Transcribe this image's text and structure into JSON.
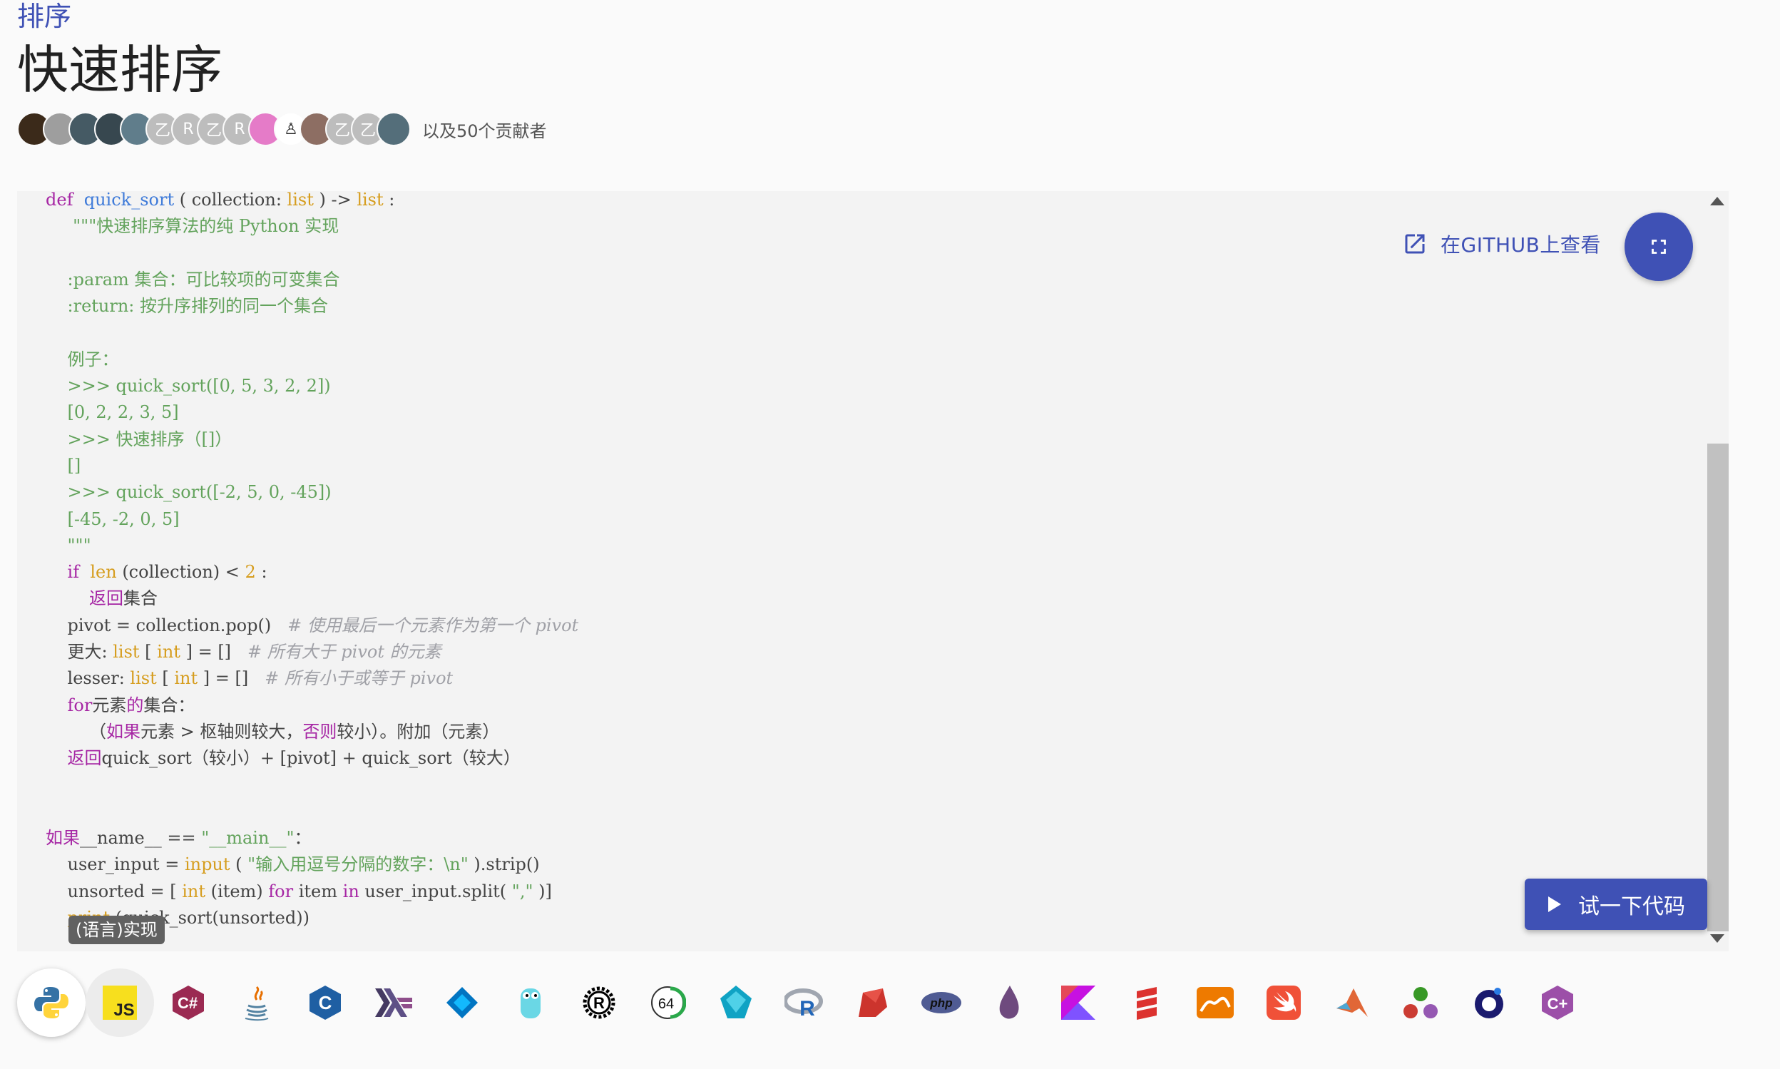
{
  "breadcrumb": "排序",
  "title": "快速排序",
  "contributors": {
    "avatars": [
      {
        "kind": "photo",
        "color": "#3b2a1a"
      },
      {
        "kind": "photo",
        "color": "#9e9e9e"
      },
      {
        "kind": "photo",
        "color": "#455a64"
      },
      {
        "kind": "photo",
        "color": "#37474f"
      },
      {
        "kind": "photo",
        "color": "#607d8b"
      },
      {
        "kind": "letter",
        "letter": "乙",
        "color": "#bdbdbd"
      },
      {
        "kind": "letter",
        "letter": "R",
        "color": "#bdbdbd"
      },
      {
        "kind": "letter",
        "letter": "乙",
        "color": "#bdbdbd"
      },
      {
        "kind": "letter",
        "letter": "R",
        "color": "#bdbdbd"
      },
      {
        "kind": "letter",
        "letter": "",
        "color": "#e57bc8"
      },
      {
        "kind": "letter",
        "letter": "♙",
        "color": "#ffffff"
      },
      {
        "kind": "photo",
        "color": "#8d6e63"
      },
      {
        "kind": "letter",
        "letter": "乙",
        "color": "#bdbdbd"
      },
      {
        "kind": "letter",
        "letter": "乙",
        "color": "#bdbdbd"
      },
      {
        "kind": "photo",
        "color": "#546e7a"
      }
    ],
    "more_text": "以及50个贡献者"
  },
  "code_lines": [
    [
      {
        "t": "def  ",
        "c": "m"
      },
      {
        "t": "quick_sort",
        "c": "b"
      },
      {
        "t": " ( collection: "
      },
      {
        "t": "list",
        "c": "o"
      },
      {
        "t": " ) -> "
      },
      {
        "t": "list",
        "c": "o"
      },
      {
        "t": " :"
      }
    ],
    [
      {
        "t": "     \"\"\"快速排序算法的纯 Python 实现",
        "c": "g"
      }
    ],
    [
      {
        "t": ""
      }
    ],
    [
      {
        "t": "    :param 集合：可比较项的可变集合",
        "c": "g"
      }
    ],
    [
      {
        "t": "    :return: 按升序排列的同一个集合",
        "c": "g"
      }
    ],
    [
      {
        "t": ""
      }
    ],
    [
      {
        "t": "    例子：",
        "c": "g"
      }
    ],
    [
      {
        "t": "    >>> quick_sort([0, 5, 3, 2, 2])",
        "c": "g"
      }
    ],
    [
      {
        "t": "    [0, 2, 2, 3, 5]",
        "c": "g"
      }
    ],
    [
      {
        "t": "    >>> 快速排序（[]）",
        "c": "g"
      }
    ],
    [
      {
        "t": "    []",
        "c": "g"
      }
    ],
    [
      {
        "t": "    >>> quick_sort([-2, 5, 0, -45])",
        "c": "g"
      }
    ],
    [
      {
        "t": "    [-45, -2, 0, 5]",
        "c": "g"
      }
    ],
    [
      {
        "t": "    \"\"\"",
        "c": "g"
      }
    ],
    [
      {
        "t": "    "
      },
      {
        "t": "if",
        "c": "m"
      },
      {
        "t": "  "
      },
      {
        "t": "len",
        "c": "o"
      },
      {
        "t": " (collection) < "
      },
      {
        "t": "2",
        "c": "o"
      },
      {
        "t": " :"
      }
    ],
    [
      {
        "t": "        "
      },
      {
        "t": "返回",
        "c": "m"
      },
      {
        "t": "集合"
      }
    ],
    [
      {
        "t": "    pivot = collection.pop()   "
      },
      {
        "t": "# 使用最后一个元素作为第一个 pivot",
        "c": "c"
      }
    ],
    [
      {
        "t": "    更大: "
      },
      {
        "t": "list",
        "c": "o"
      },
      {
        "t": " [ "
      },
      {
        "t": "int",
        "c": "o"
      },
      {
        "t": " ] = []   "
      },
      {
        "t": "# 所有大于 pivot 的元素",
        "c": "c"
      }
    ],
    [
      {
        "t": "    lesser: "
      },
      {
        "t": "list",
        "c": "o"
      },
      {
        "t": " [ "
      },
      {
        "t": "int",
        "c": "o"
      },
      {
        "t": " ] = []   "
      },
      {
        "t": "# 所有小于或等于 pivot",
        "c": "c"
      }
    ],
    [
      {
        "t": "    "
      },
      {
        "t": "for",
        "c": "m"
      },
      {
        "t": "元素"
      },
      {
        "t": "的",
        "c": "m"
      },
      {
        "t": "集合："
      }
    ],
    [
      {
        "t": "        （"
      },
      {
        "t": "如果",
        "c": "m"
      },
      {
        "t": "元素 > 枢轴则较大，"
      },
      {
        "t": "否则",
        "c": "m"
      },
      {
        "t": "较小）。附加（元素）"
      }
    ],
    [
      {
        "t": "    "
      },
      {
        "t": "返回",
        "c": "m"
      },
      {
        "t": "quick_sort（较小）+ [pivot] + quick_sort（较大）"
      }
    ],
    [
      {
        "t": ""
      }
    ],
    [
      {
        "t": ""
      }
    ],
    [
      {
        "t": "如果",
        "c": "m"
      },
      {
        "t": "__name__ == "
      },
      {
        "t": "\"__main__\"",
        "c": "g"
      },
      {
        "t": "："
      }
    ],
    [
      {
        "t": "    user_input = "
      },
      {
        "t": "input",
        "c": "o"
      },
      {
        "t": " ( "
      },
      {
        "t": "\"输入用逗号分隔的数字：\\n\"",
        "c": "g"
      },
      {
        "t": " ).strip()"
      }
    ],
    [
      {
        "t": "    unsorted = [ "
      },
      {
        "t": "int",
        "c": "o"
      },
      {
        "t": " (item) "
      },
      {
        "t": "for",
        "c": "m"
      },
      {
        "t": " item "
      },
      {
        "t": "in",
        "c": "m"
      },
      {
        "t": " user_input.split( "
      },
      {
        "t": "\",\"",
        "c": "g"
      },
      {
        "t": " )]"
      }
    ],
    [
      {
        "t": "    "
      },
      {
        "t": "print",
        "c": "o"
      },
      {
        "t": " (quick_sort(unsorted))"
      }
    ]
  ],
  "github_label": "在GITHUB上查看",
  "try_label": "试一下代码",
  "tooltip": "(语言)实现",
  "languages": [
    "Python",
    "JavaScript",
    "C#",
    "Java",
    "C",
    "Haskell",
    "Dart",
    "Go",
    "Rust",
    "Assembly x64",
    "Zig",
    "R",
    "Ruby",
    "PHP",
    "Elixir",
    "Kotlin",
    "Scala",
    "OCaml",
    "Swift",
    "MATLAB",
    "Julia",
    "Nim",
    "C++"
  ],
  "lang_icons": {
    "js_text": "JS",
    "csharp_text": "C#",
    "c_text": "C",
    "r_text": "R",
    "php_text": "php",
    "asm_text": "64",
    "cpp_text": "C+"
  }
}
